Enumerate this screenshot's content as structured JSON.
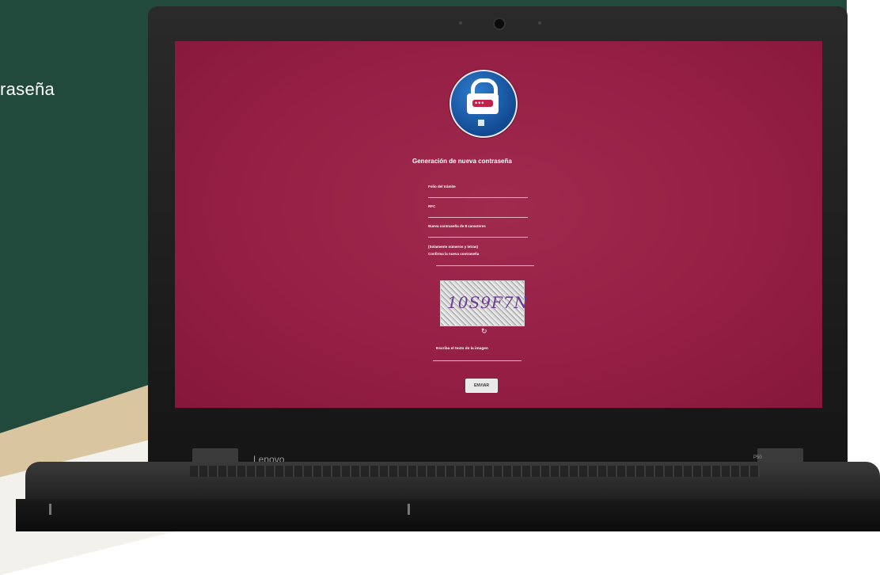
{
  "page": {
    "side_title": "raseña"
  },
  "laptop": {
    "brand": "Lenovo",
    "model": "P50"
  },
  "form": {
    "title": "Generación de nueva contraseña",
    "fields": [
      {
        "label": "Folio del trámite"
      },
      {
        "label": "RFC"
      },
      {
        "label": "Nueva contraseña de 8 caracteres"
      },
      {
        "label": "(Solamente números y letras)"
      },
      {
        "label": "Confirma la nueva contraseña"
      }
    ],
    "captcha_text": "10S9F7N",
    "refresh_icon": "↻",
    "captcha_label": "Escriba el texto de la imagen",
    "submit_label": "ENVIAR"
  },
  "colors": {
    "background_green": "#214a3d",
    "screen_crimson": "#961f45",
    "logo_blue": "#124a92"
  }
}
